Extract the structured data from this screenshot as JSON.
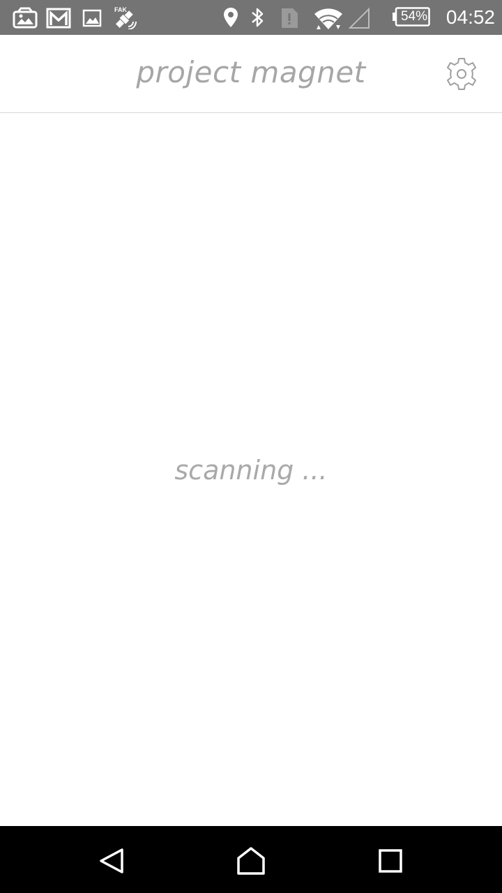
{
  "status_bar": {
    "battery_level": "54%",
    "time": "04:52",
    "icons": [
      "photo-notification-icon",
      "gmail-icon",
      "image-icon",
      "fake-gps-icon",
      "location-icon",
      "bluetooth-icon",
      "sim-alert-icon",
      "wifi-icon",
      "cell-signal-icon",
      "battery-icon"
    ],
    "background_color": "#747474"
  },
  "app_bar": {
    "title": "project magnet",
    "settings_icon": "gear-icon"
  },
  "main": {
    "status_text": "scanning ..."
  },
  "nav_bar": {
    "buttons": [
      "back-icon",
      "home-icon",
      "recents-icon"
    ]
  },
  "colors": {
    "text_muted": "#a6a6a6",
    "divider": "#d9d9d9"
  }
}
